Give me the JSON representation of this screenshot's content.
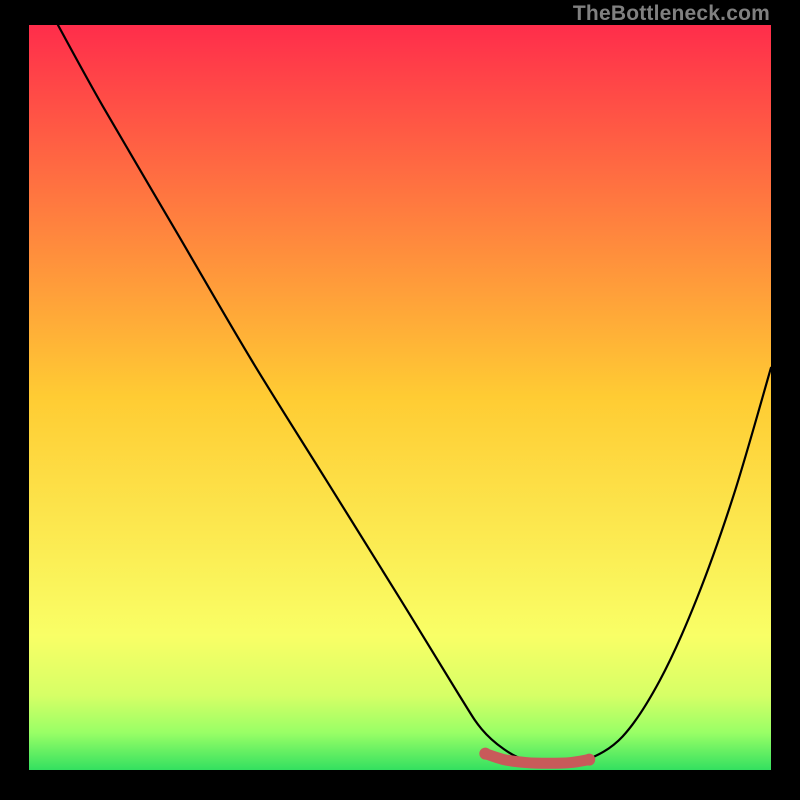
{
  "watermark": "TheBottleneck.com",
  "colors": {
    "frame": "#000000",
    "curve": "#000000",
    "marker": "#c85a5a",
    "gradient_top": "#ff2d4b",
    "gradient_mid": "#ffcc33",
    "gradient_low1": "#f9ff66",
    "gradient_low2": "#d6ff66",
    "gradient_low3": "#99ff66",
    "gradient_bottom": "#33e060"
  },
  "chart_data": {
    "type": "line",
    "title": "",
    "xlabel": "",
    "ylabel": "",
    "xlim": [
      0,
      100
    ],
    "ylim": [
      0,
      100
    ],
    "series": [
      {
        "name": "bottleneck-curve",
        "x": [
          3.9,
          10,
          20,
          30,
          40,
          50,
          58,
          61,
          64,
          67,
          71,
          75,
          80,
          85,
          90,
          95,
          100
        ],
        "y": [
          100,
          89,
          72,
          55,
          39,
          23,
          10,
          5.5,
          2.8,
          1.3,
          0.9,
          1.3,
          4.5,
          12,
          23,
          37,
          54
        ]
      }
    ],
    "highlight_segment": {
      "name": "flat-minimum",
      "x": [
        61.5,
        64,
        67,
        70,
        73,
        75.5
      ],
      "y": [
        2.2,
        1.4,
        1.0,
        0.9,
        1.0,
        1.4
      ]
    },
    "background": {
      "type": "vertical-gradient",
      "stops": [
        {
          "pos": 0.0,
          "color": "#ff2d4b"
        },
        {
          "pos": 0.5,
          "color": "#ffcc33"
        },
        {
          "pos": 0.82,
          "color": "#f9ff66"
        },
        {
          "pos": 0.9,
          "color": "#d6ff66"
        },
        {
          "pos": 0.95,
          "color": "#99ff66"
        },
        {
          "pos": 1.0,
          "color": "#33e060"
        }
      ]
    }
  }
}
